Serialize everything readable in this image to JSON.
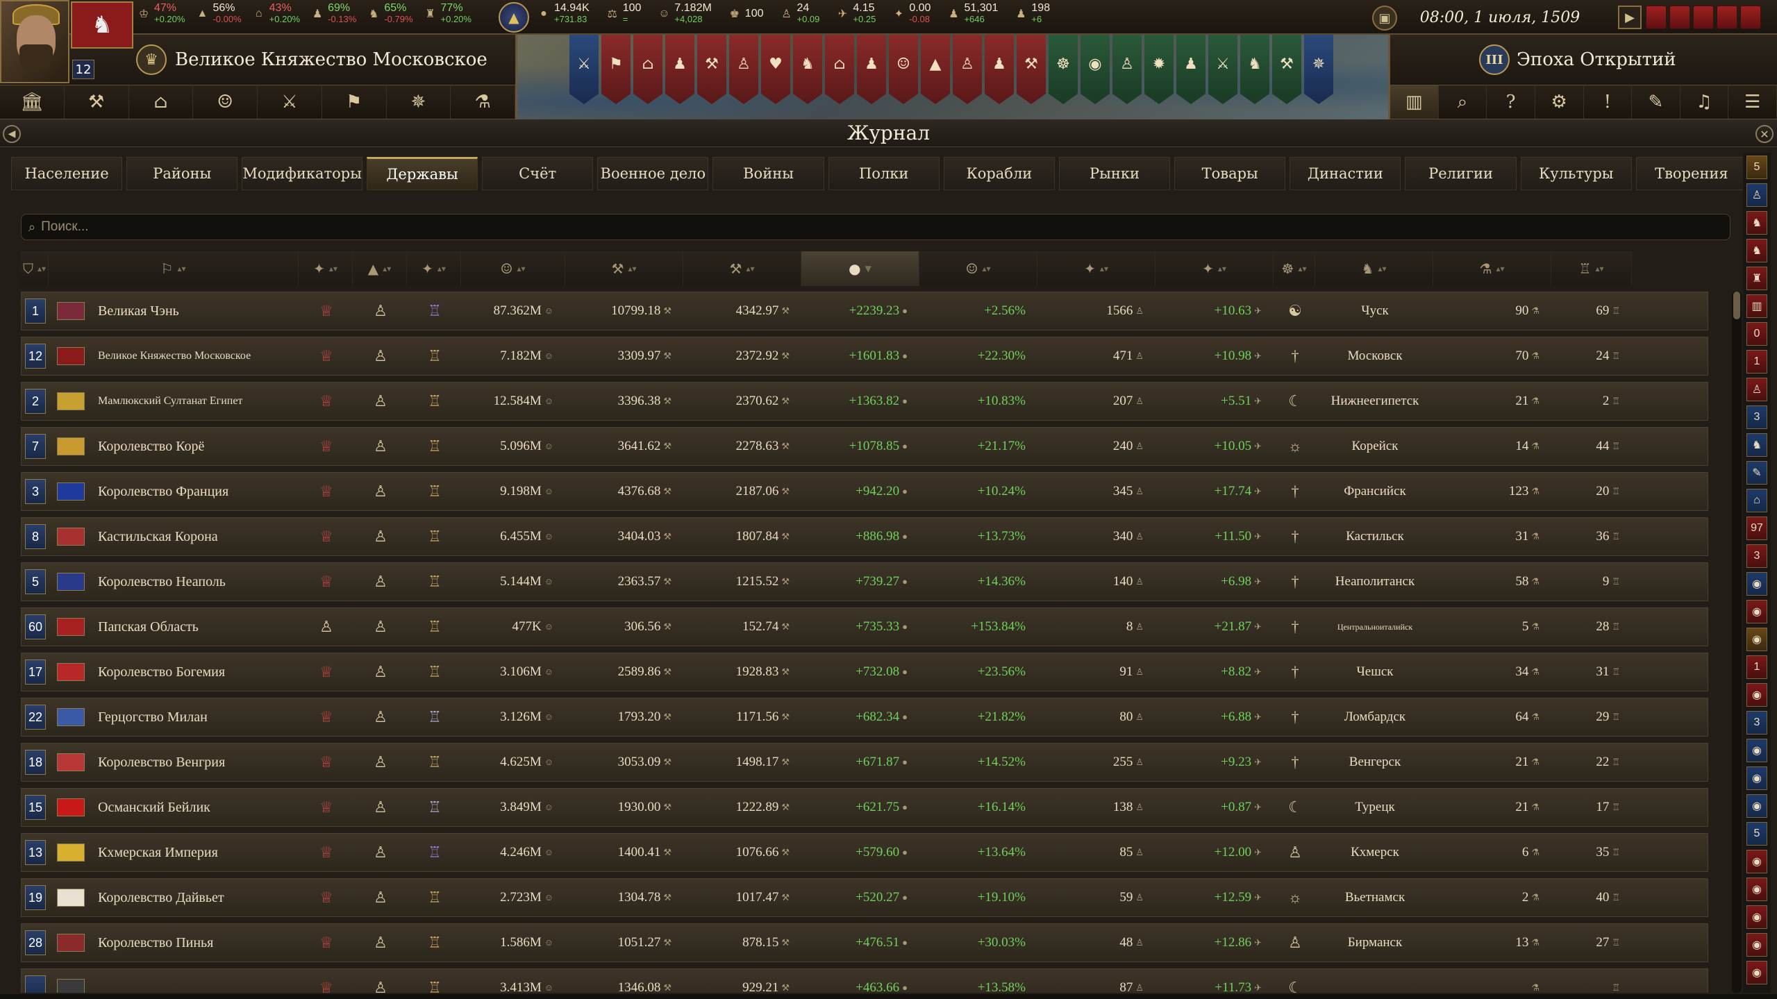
{
  "topbar": {
    "stats_left": [
      {
        "icon": "crown-icon",
        "glyph": "♔",
        "value": "47%",
        "delta": "+0.20%",
        "vcls": "red",
        "dcls": "pos"
      },
      {
        "icon": "tent-icon",
        "glyph": "▲",
        "value": "56%",
        "delta": "-0.00%",
        "vcls": "",
        "dcls": "neg"
      },
      {
        "icon": "estate-icon",
        "glyph": "⌂",
        "value": "43%",
        "delta": "+0.20%",
        "vcls": "red",
        "dcls": "pos"
      },
      {
        "icon": "faction-icon",
        "glyph": "♟",
        "value": "69%",
        "delta": "-0.13%",
        "vcls": "green",
        "dcls": "neg"
      },
      {
        "icon": "group-icon",
        "glyph": "♞",
        "value": "65%",
        "delta": "-0.79%",
        "vcls": "green",
        "dcls": "neg"
      },
      {
        "icon": "power-icon",
        "glyph": "♜",
        "value": "77%",
        "delta": "+0.20%",
        "vcls": "green",
        "dcls": "pos"
      }
    ],
    "stats_mid": [
      {
        "icon": "gold-icon",
        "glyph": "●",
        "value": "14.94K",
        "delta": "+731.83"
      },
      {
        "icon": "scales-icon",
        "glyph": "⚖",
        "value": "100",
        "delta": "="
      },
      {
        "icon": "population-icon",
        "glyph": "☺",
        "value": "7.182M",
        "delta": "+4,028"
      },
      {
        "icon": "manpower-icon",
        "glyph": "♚",
        "value": "100",
        "delta": ""
      },
      {
        "icon": "stability-icon",
        "glyph": "♙",
        "value": "24",
        "delta": "+0.09"
      },
      {
        "icon": "prestige-icon",
        "glyph": "✈",
        "value": "4.15",
        "delta": "+0.25"
      },
      {
        "icon": "war-exhaustion-icon",
        "glyph": "✦",
        "value": "0.00",
        "delta": "-0.08"
      },
      {
        "icon": "troops-icon",
        "glyph": "♟",
        "value": "51,301",
        "delta": "+646"
      },
      {
        "icon": "ships-icon",
        "glyph": "♟",
        "value": "198",
        "delta": "+6"
      }
    ],
    "date": "08:00, 1 июля, 1509"
  },
  "country": {
    "name": "Великое Княжество Московское",
    "rank": "12"
  },
  "age": {
    "name": "Эпоха Открытий",
    "numeral": "III"
  },
  "nav_left": [
    {
      "icon": "court-icon",
      "glyph": "🏛"
    },
    {
      "icon": "economy-icon",
      "glyph": "⚒"
    },
    {
      "icon": "buildings-icon",
      "glyph": "⌂"
    },
    {
      "icon": "diplomacy-icon",
      "glyph": "☺"
    },
    {
      "icon": "military-icon",
      "glyph": "⚔"
    },
    {
      "icon": "army-icon",
      "glyph": "⚑"
    },
    {
      "icon": "religion-icon",
      "glyph": "✵"
    },
    {
      "icon": "advances-icon",
      "glyph": "⚗"
    }
  ],
  "nav_right": [
    {
      "icon": "journal-icon",
      "glyph": "▥",
      "active": true
    },
    {
      "icon": "search-map-icon",
      "glyph": "⌕",
      "active": false
    },
    {
      "icon": "help-icon",
      "glyph": "?",
      "active": false
    },
    {
      "icon": "settings-icon",
      "glyph": "⚙",
      "active": false
    },
    {
      "icon": "alert-icon",
      "glyph": "!",
      "active": false
    },
    {
      "icon": "quill-icon",
      "glyph": "✎",
      "active": false
    },
    {
      "icon": "music-icon",
      "glyph": "♫",
      "active": false
    },
    {
      "icon": "menu-icon",
      "glyph": "☰",
      "active": false
    }
  ],
  "banners": [
    {
      "cls": "b",
      "glyph": "⚔"
    },
    {
      "cls": "r",
      "glyph": "⚑"
    },
    {
      "cls": "r",
      "glyph": "⌂"
    },
    {
      "cls": "r",
      "glyph": "♟"
    },
    {
      "cls": "r",
      "glyph": "⚒"
    },
    {
      "cls": "r",
      "glyph": "♙"
    },
    {
      "cls": "r",
      "glyph": "♥"
    },
    {
      "cls": "r",
      "glyph": "♞"
    },
    {
      "cls": "r",
      "glyph": "⌂"
    },
    {
      "cls": "r",
      "glyph": "♟"
    },
    {
      "cls": "r",
      "glyph": "☺"
    },
    {
      "cls": "r",
      "glyph": "▲"
    },
    {
      "cls": "r",
      "glyph": "♙"
    },
    {
      "cls": "r",
      "glyph": "♟"
    },
    {
      "cls": "r",
      "glyph": "⚒"
    },
    {
      "cls": "g",
      "glyph": "☸"
    },
    {
      "cls": "g",
      "glyph": "◉"
    },
    {
      "cls": "g",
      "glyph": "♙"
    },
    {
      "cls": "g",
      "glyph": "✹"
    },
    {
      "cls": "g",
      "glyph": "♟"
    },
    {
      "cls": "g",
      "glyph": "⚔"
    },
    {
      "cls": "g",
      "glyph": "♞"
    },
    {
      "cls": "g",
      "glyph": "⚒"
    },
    {
      "cls": "b",
      "glyph": "✵"
    }
  ],
  "journal": {
    "title": "Журнал",
    "tabs": [
      {
        "label": "Население",
        "active": false
      },
      {
        "label": "Районы",
        "active": false
      },
      {
        "label": "Модификаторы",
        "active": false
      },
      {
        "label": "Державы",
        "active": true
      },
      {
        "label": "Счёт",
        "active": false
      },
      {
        "label": "Военное дело",
        "active": false
      },
      {
        "label": "Войны",
        "active": false
      },
      {
        "label": "Полки",
        "active": false
      },
      {
        "label": "Корабли",
        "active": false
      },
      {
        "label": "Рынки",
        "active": false
      },
      {
        "label": "Товары",
        "active": false
      },
      {
        "label": "Династии",
        "active": false
      },
      {
        "label": "Религии",
        "active": false
      },
      {
        "label": "Культуры",
        "active": false
      },
      {
        "label": "Творения",
        "active": false
      }
    ],
    "search_placeholder": "Поиск...",
    "columns": [
      {
        "icon": "rank-col-icon",
        "glyph": "⛉",
        "w": 40,
        "sorted": false
      },
      {
        "icon": "flag-col-icon",
        "glyph": "⚐",
        "w": 360,
        "sorted": false
      },
      {
        "icon": "govt-col-icon",
        "glyph": "✦",
        "w": 78,
        "sorted": false
      },
      {
        "icon": "rank-tier-col-icon",
        "glyph": "▲",
        "w": 78,
        "sorted": false
      },
      {
        "icon": "estate-col-icon",
        "glyph": "✦",
        "w": 78,
        "sorted": false
      },
      {
        "icon": "population-col-icon",
        "glyph": "☺",
        "w": 150,
        "sorted": false
      },
      {
        "icon": "dev-col-icon",
        "glyph": "⚒",
        "w": 170,
        "sorted": false
      },
      {
        "icon": "tax-col-icon",
        "glyph": "⚒",
        "w": 170,
        "sorted": false
      },
      {
        "icon": "income-col-icon",
        "glyph": "●",
        "w": 170,
        "sorted": true
      },
      {
        "icon": "growth-col-icon",
        "glyph": "☺",
        "w": 170,
        "sorted": false
      },
      {
        "icon": "prestige-col-icon",
        "glyph": "✦",
        "w": 170,
        "sorted": false
      },
      {
        "icon": "power-col-icon",
        "glyph": "✦",
        "w": 170,
        "sorted": false
      },
      {
        "icon": "religion-col-icon",
        "glyph": "☸",
        "w": 60,
        "sorted": false
      },
      {
        "icon": "culture-col-icon",
        "glyph": "♞",
        "w": 170,
        "sorted": false
      },
      {
        "icon": "advances-col-icon",
        "glyph": "⚗",
        "w": 170,
        "sorted": false
      },
      {
        "icon": "dynasty-col-icon",
        "glyph": "♖",
        "w": 116,
        "sorted": false
      }
    ],
    "rows": [
      {
        "rank": "1",
        "flag": "#7a2a3a",
        "name": "Великая Чэнь",
        "small": false,
        "i1": "♕",
        "i1c": "#d04848",
        "i2": "♙",
        "i3": "♖",
        "i3c": "#9a78d8",
        "pop": "87.362M",
        "n1": "10799.18",
        "n2": "4342.97",
        "inc": "+2239.23",
        "pct": "+2.56%",
        "n3": "1566",
        "n4": "+10.63",
        "rel": "☯",
        "cult": "Чуск",
        "csmall": false,
        "n5": "90",
        "n6": "69"
      },
      {
        "rank": "12",
        "flag": "#8b1a1a",
        "name": "Великое Княжество Московское",
        "small": true,
        "i1": "♕",
        "i1c": "#d04848",
        "i2": "♙",
        "i3": "♖",
        "i3c": "#c8a860",
        "pop": "7.182M",
        "n1": "3309.97",
        "n2": "2372.92",
        "inc": "+1601.83",
        "pct": "+22.30%",
        "n3": "471",
        "n4": "+10.98",
        "rel": "†",
        "cult": "Московск",
        "csmall": false,
        "n5": "70",
        "n6": "24"
      },
      {
        "rank": "2",
        "flag": "#c8a030",
        "name": "Мамлюкский Султанат Египет",
        "small": true,
        "i1": "♕",
        "i1c": "#d04848",
        "i2": "♙",
        "i3": "♖",
        "i3c": "#c8a860",
        "pop": "12.584M",
        "n1": "3396.38",
        "n2": "2370.62",
        "inc": "+1363.82",
        "pct": "+10.83%",
        "n3": "207",
        "n4": "+5.51",
        "rel": "☾",
        "cult": "Нижнеегипетск",
        "csmall": false,
        "n5": "21",
        "n6": "2"
      },
      {
        "rank": "7",
        "flag": "#c89a30",
        "name": "Королевство Корё",
        "small": false,
        "i1": "♕",
        "i1c": "#d04848",
        "i2": "♙",
        "i3": "♖",
        "i3c": "#c8a860",
        "pop": "5.096M",
        "n1": "3641.62",
        "n2": "2278.63",
        "inc": "+1078.85",
        "pct": "+21.17%",
        "n3": "240",
        "n4": "+10.05",
        "rel": "☼",
        "cult": "Корейск",
        "csmall": false,
        "n5": "14",
        "n6": "44"
      },
      {
        "rank": "3",
        "flag": "#1e3a9a",
        "name": "Королевство Франция",
        "small": false,
        "i1": "♕",
        "i1c": "#d04848",
        "i2": "♙",
        "i3": "♖",
        "i3c": "#c8a860",
        "pop": "9.198M",
        "n1": "4376.68",
        "n2": "2187.06",
        "inc": "+942.20",
        "pct": "+10.24%",
        "n3": "345",
        "n4": "+17.74",
        "rel": "†",
        "cult": "Франсийск",
        "csmall": false,
        "n5": "123",
        "n6": "20"
      },
      {
        "rank": "8",
        "flag": "#a83030",
        "name": "Кастильская Корона",
        "small": false,
        "i1": "♕",
        "i1c": "#d04848",
        "i2": "♙",
        "i3": "♖",
        "i3c": "#c8a860",
        "pop": "6.455M",
        "n1": "3404.03",
        "n2": "1807.84",
        "inc": "+886.98",
        "pct": "+13.73%",
        "n3": "340",
        "n4": "+11.50",
        "rel": "†",
        "cult": "Кастильск",
        "csmall": false,
        "n5": "31",
        "n6": "36"
      },
      {
        "rank": "5",
        "flag": "#2a3a8a",
        "name": "Королевство Неаполь",
        "small": false,
        "i1": "♕",
        "i1c": "#d04848",
        "i2": "♙",
        "i3": "♖",
        "i3c": "#c8a860",
        "pop": "5.144M",
        "n1": "2363.57",
        "n2": "1215.52",
        "inc": "+739.27",
        "pct": "+14.36%",
        "n3": "140",
        "n4": "+6.98",
        "rel": "†",
        "cult": "Неаполитанск",
        "csmall": false,
        "n5": "58",
        "n6": "9"
      },
      {
        "rank": "60",
        "flag": "#a82020",
        "name": "Папская Область",
        "small": false,
        "i1": "♙",
        "i1c": "#e0c8b0",
        "i2": "♙",
        "i3": "♖",
        "i3c": "#c8a860",
        "pop": "477K",
        "n1": "306.56",
        "n2": "152.74",
        "inc": "+735.33",
        "pct": "+153.84%",
        "n3": "8",
        "n4": "+21.87",
        "rel": "†",
        "cult": "Центральноиталийск",
        "csmall": true,
        "n5": "5",
        "n6": "28"
      },
      {
        "rank": "17",
        "flag": "#b82828",
        "name": "Королевство Богемия",
        "small": false,
        "i1": "♕",
        "i1c": "#d04848",
        "i2": "♙",
        "i3": "♖",
        "i3c": "#c8a860",
        "pop": "3.106M",
        "n1": "2589.86",
        "n2": "1928.83",
        "inc": "+732.08",
        "pct": "+23.56%",
        "n3": "91",
        "n4": "+8.82",
        "rel": "†",
        "cult": "Чешск",
        "csmall": false,
        "n5": "34",
        "n6": "31"
      },
      {
        "rank": "22",
        "flag": "#3a5aa8",
        "name": "Герцогство Милан",
        "small": false,
        "i1": "♕",
        "i1c": "#d04848",
        "i2": "♙",
        "i3": "♖",
        "i3c": "#a8a8c8",
        "pop": "3.126M",
        "n1": "1793.20",
        "n2": "1171.56",
        "inc": "+682.34",
        "pct": "+21.82%",
        "n3": "80",
        "n4": "+6.88",
        "rel": "†",
        "cult": "Ломбардск",
        "csmall": false,
        "n5": "64",
        "n6": "29"
      },
      {
        "rank": "18",
        "flag": "#b83838",
        "name": "Королевство Венгрия",
        "small": false,
        "i1": "♕",
        "i1c": "#d04848",
        "i2": "♙",
        "i3": "♖",
        "i3c": "#c8a860",
        "pop": "4.625M",
        "n1": "3053.09",
        "n2": "1498.17",
        "inc": "+671.87",
        "pct": "+14.52%",
        "n3": "255",
        "n4": "+9.23",
        "rel": "†",
        "cult": "Венгерск",
        "csmall": false,
        "n5": "21",
        "n6": "22"
      },
      {
        "rank": "15",
        "flag": "#c81818",
        "name": "Османский Бейлик",
        "small": false,
        "i1": "♕",
        "i1c": "#d04848",
        "i2": "♙",
        "i3": "♖",
        "i3c": "#a8a8c8",
        "pop": "3.849M",
        "n1": "1930.00",
        "n2": "1222.89",
        "inc": "+621.75",
        "pct": "+16.14%",
        "n3": "138",
        "n4": "+0.87",
        "rel": "☾",
        "cult": "Турецк",
        "csmall": false,
        "n5": "21",
        "n6": "17"
      },
      {
        "rank": "13",
        "flag": "#d8b030",
        "name": "Кхмерская Империя",
        "small": false,
        "i1": "♕",
        "i1c": "#d04848",
        "i2": "♙",
        "i3": "♖",
        "i3c": "#9a78d8",
        "pop": "4.246M",
        "n1": "1400.41",
        "n2": "1076.66",
        "inc": "+579.60",
        "pct": "+13.64%",
        "n3": "85",
        "n4": "+12.00",
        "rel": "♙",
        "cult": "Кхмерск",
        "csmall": false,
        "n5": "6",
        "n6": "35"
      },
      {
        "rank": "19",
        "flag": "#e8e0d0",
        "name": "Королевство Дайвьет",
        "small": false,
        "i1": "♕",
        "i1c": "#d04848",
        "i2": "♙",
        "i3": "♖",
        "i3c": "#c8a860",
        "pop": "2.723M",
        "n1": "1304.78",
        "n2": "1017.47",
        "inc": "+520.27",
        "pct": "+19.10%",
        "n3": "59",
        "n4": "+12.59",
        "rel": "☼",
        "cult": "Вьетнамск",
        "csmall": false,
        "n5": "2",
        "n6": "40"
      },
      {
        "rank": "28",
        "flag": "#8a2a2a",
        "name": "Королевство Пинья",
        "small": false,
        "i1": "♕",
        "i1c": "#d04848",
        "i2": "♙",
        "i3": "♖",
        "i3c": "#c8a860",
        "pop": "1.586M",
        "n1": "1051.27",
        "n2": "878.15",
        "inc": "+476.51",
        "pct": "+30.03%",
        "n3": "48",
        "n4": "+12.86",
        "rel": "♙",
        "cult": "Бирманск",
        "csmall": false,
        "n5": "13",
        "n6": "27"
      },
      {
        "rank": "",
        "flag": "#3a3a3a",
        "name": "",
        "small": false,
        "i1": "♕",
        "i1c": "#d04848",
        "i2": "♙",
        "i3": "♖",
        "i3c": "#c8a860",
        "pop": "3.413M",
        "n1": "1346.08",
        "n2": "929.21",
        "inc": "+463.66",
        "pct": "+13.58%",
        "n3": "87",
        "n4": "+11.73",
        "rel": "☾",
        "cult": "",
        "csmall": false,
        "n5": "",
        "n6": ""
      }
    ]
  },
  "right_sidebar": [
    {
      "cls": "orange",
      "label": "5"
    },
    {
      "cls": "blue",
      "label": "♙"
    },
    {
      "cls": "red",
      "label": "♞"
    },
    {
      "cls": "red",
      "label": "♞"
    },
    {
      "cls": "red",
      "label": "♜"
    },
    {
      "cls": "red",
      "label": "▥"
    },
    {
      "cls": "red",
      "label": "0"
    },
    {
      "cls": "red",
      "label": "1"
    },
    {
      "cls": "red",
      "label": "♙"
    },
    {
      "cls": "blue",
      "label": "3"
    },
    {
      "cls": "blue",
      "label": "♞"
    },
    {
      "cls": "blue",
      "label": "✎"
    },
    {
      "cls": "blue",
      "label": "⌂"
    },
    {
      "cls": "red",
      "label": "97"
    },
    {
      "cls": "red",
      "label": "3"
    },
    {
      "cls": "blue",
      "label": "◉"
    },
    {
      "cls": "red",
      "label": "◉"
    },
    {
      "cls": "orange",
      "label": "◉"
    },
    {
      "cls": "red",
      "label": "1"
    },
    {
      "cls": "red",
      "label": "◉"
    },
    {
      "cls": "blue",
      "label": "3"
    },
    {
      "cls": "blue",
      "label": "◉"
    },
    {
      "cls": "blue",
      "label": "◉"
    },
    {
      "cls": "blue",
      "label": "◉"
    },
    {
      "cls": "blue",
      "label": "5"
    },
    {
      "cls": "red",
      "label": "◉"
    },
    {
      "cls": "red",
      "label": "◉"
    },
    {
      "cls": "red",
      "label": "◉"
    },
    {
      "cls": "red",
      "label": "◉"
    },
    {
      "cls": "red",
      "label": "◉"
    }
  ]
}
